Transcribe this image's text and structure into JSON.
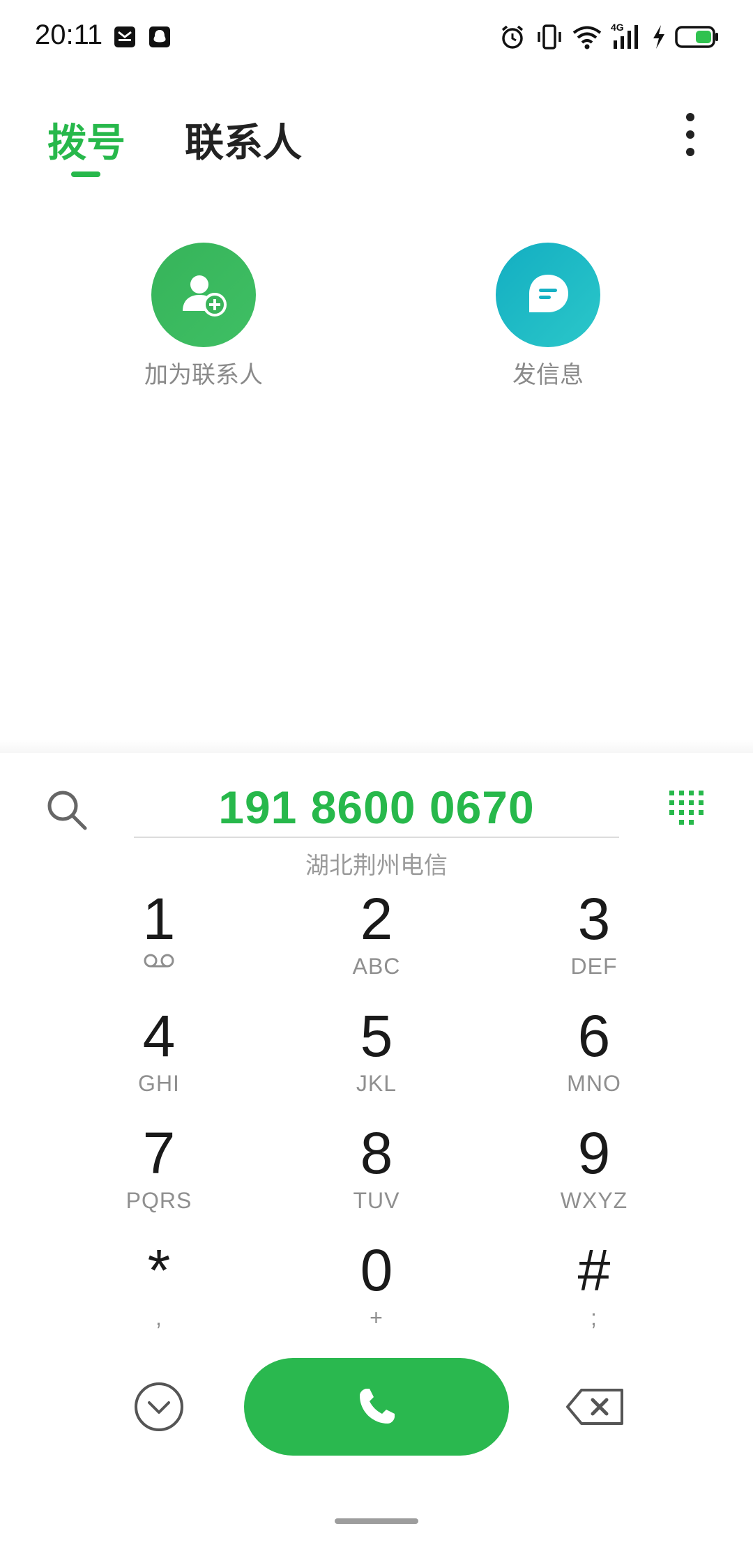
{
  "status_bar": {
    "time": "20:11",
    "network": "4G",
    "accent": "#27b84b"
  },
  "tabs": [
    {
      "label": "拨号",
      "active": true
    },
    {
      "label": "联系人",
      "active": false
    }
  ],
  "actions": {
    "add_contact": {
      "label": "加为联系人",
      "icon": "add-contact-icon",
      "color": "#3ab45a"
    },
    "send_message": {
      "label": "发信息",
      "icon": "message-icon",
      "color": "#1cb4c4"
    }
  },
  "dialer": {
    "number": "191 8600 0670",
    "location": "湖北荆州电信"
  },
  "keypad": [
    {
      "digit": "1",
      "letters": ""
    },
    {
      "digit": "2",
      "letters": "ABC"
    },
    {
      "digit": "3",
      "letters": "DEF"
    },
    {
      "digit": "4",
      "letters": "GHI"
    },
    {
      "digit": "5",
      "letters": "JKL"
    },
    {
      "digit": "6",
      "letters": "MNO"
    },
    {
      "digit": "7",
      "letters": "PQRS"
    },
    {
      "digit": "8",
      "letters": "TUV"
    },
    {
      "digit": "9",
      "letters": "WXYZ"
    },
    {
      "digit": "*",
      "letters": ","
    },
    {
      "digit": "0",
      "letters": "+"
    },
    {
      "digit": "#",
      "letters": ";"
    }
  ],
  "colors": {
    "accent_green": "#27b84b",
    "call_button": "#2ab84f",
    "secondary_text": "#8f8f8f"
  }
}
